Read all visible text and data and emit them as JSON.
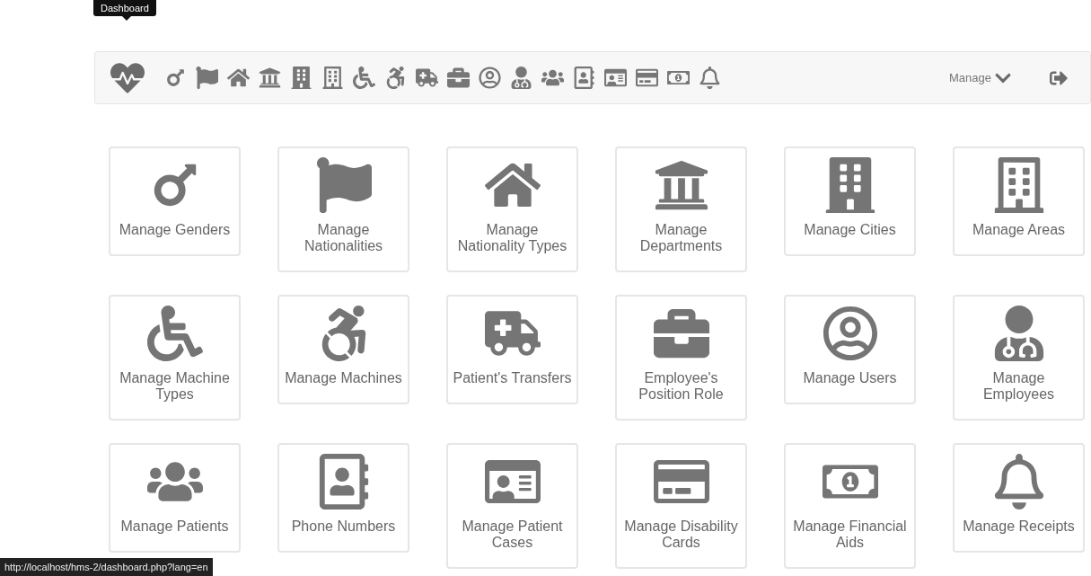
{
  "tooltip": {
    "label": "Dashboard"
  },
  "navbar": {
    "manage_menu": {
      "label": "Manage"
    }
  },
  "cards": [
    {
      "label": "Manage Genders"
    },
    {
      "label": "Manage Nationalities"
    },
    {
      "label": "Manage Nationality Types"
    },
    {
      "label": "Manage Departments"
    },
    {
      "label": "Manage Cities"
    },
    {
      "label": "Manage Areas"
    },
    {
      "label": "Manage Machine Types"
    },
    {
      "label": "Manage Machines"
    },
    {
      "label": "Patient's Transfers"
    },
    {
      "label": "Employee's Position Role"
    },
    {
      "label": "Manage Users"
    },
    {
      "label": "Manage Employees"
    },
    {
      "label": "Manage Patients"
    },
    {
      "label": "Phone Numbers"
    },
    {
      "label": "Manage Patient Cases"
    },
    {
      "label": "Manage Disability Cards"
    },
    {
      "label": "Manage Financial Aids"
    },
    {
      "label": "Manage Receipts"
    }
  ],
  "status_bar": {
    "url": "http://localhost/hms-2/dashboard.php?lang=en"
  }
}
